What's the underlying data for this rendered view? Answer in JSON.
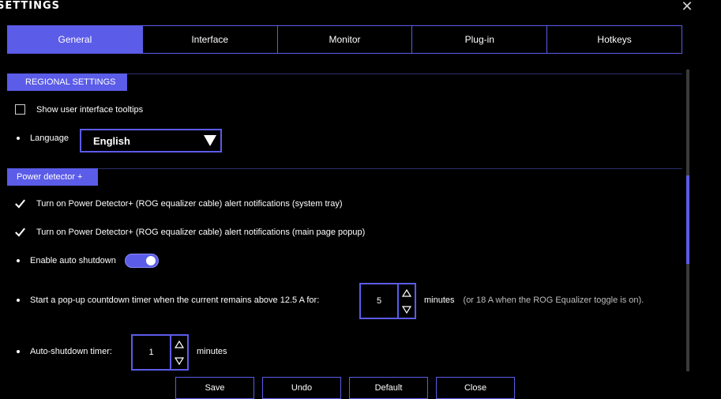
{
  "window": {
    "title": "SETTINGS"
  },
  "tabs": [
    "General",
    "Interface",
    "Monitor",
    "Plug-in",
    "Hotkeys"
  ],
  "regional": {
    "header": "REGIONAL SETTINGS",
    "tooltips_label": "Show user interface tooltips",
    "tooltips_checked": false,
    "language_label": "Language",
    "language_value": "English"
  },
  "power": {
    "header": "Power detector +",
    "alert_tray_label": "Turn on Power Detector+ (ROG equalizer cable) alert notifications (system tray)",
    "alert_popup_label": "Turn on Power Detector+ (ROG equalizer cable) alert notifications (main page popup)",
    "auto_shutdown_label": "Enable auto shutdown",
    "auto_shutdown_on": true,
    "countdown_label": "Start a pop-up countdown timer when the current remains above 12.5 A for:",
    "countdown_value": "5",
    "countdown_unit": "minutes",
    "countdown_note": "(or 18 A when the ROG Equalizer toggle is on).",
    "shutdown_timer_label": "Auto-shutdown timer:",
    "shutdown_timer_value": "1",
    "shutdown_timer_unit": "minutes"
  },
  "buttons": {
    "save": "Save",
    "undo": "Undo",
    "default": "Default",
    "close": "Close"
  },
  "colors": {
    "accent": "#5b5ce8",
    "background": "#000000"
  }
}
